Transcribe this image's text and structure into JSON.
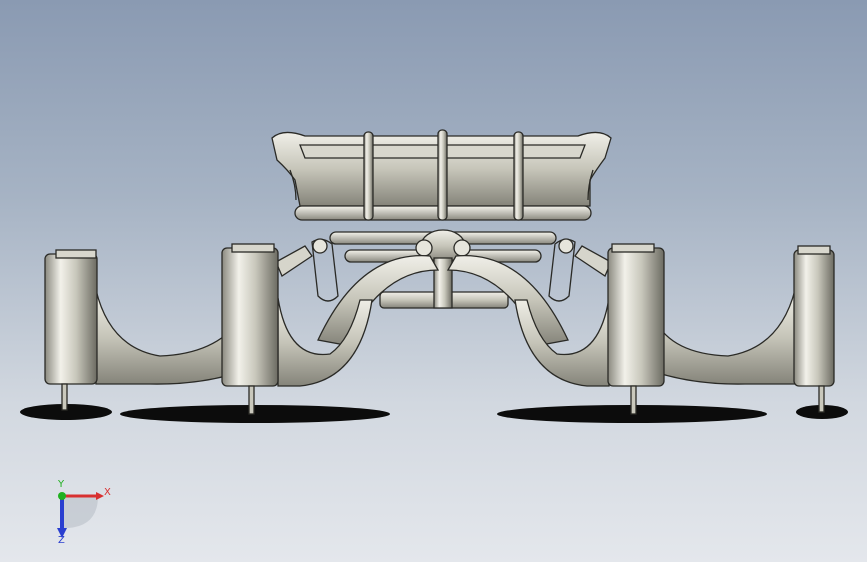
{
  "triad": {
    "x_label": "X",
    "y_label": "Y",
    "z_label": "Z",
    "x_color": "#d83030",
    "y_color": "#20b020",
    "z_color": "#2a3fd0"
  },
  "colors": {
    "metal_light": "#ecebe2",
    "metal_mid": "#b9b8ac",
    "metal_dark": "#6e6d64",
    "outline": "#2a2a26",
    "shadow": "#101010"
  }
}
